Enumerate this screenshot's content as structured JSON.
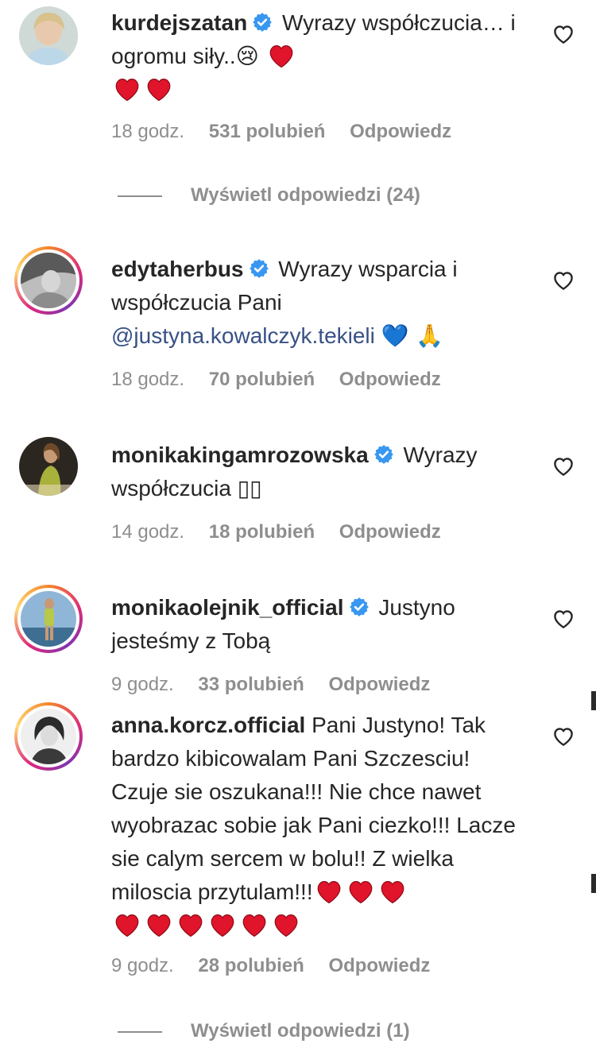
{
  "comments": [
    {
      "username": "kurdejszatan",
      "text_before_emoji": "Wyrazy współczucia… i ogromu siły..",
      "emojis_trailing": "😢",
      "time": "18 godz.",
      "likes": "531 polubień",
      "reply": "Odpowiedz",
      "view_replies": "Wyświetl odpowiedzi (24)"
    },
    {
      "username": "edytaherbus",
      "text": "Wyrazy wsparcia i współczucia Pani",
      "mention": "@justyna.kowalczyk.tekieli",
      "emojis": "💙 🙏",
      "time": "18 godz.",
      "likes": "70 polubień",
      "reply": "Odpowiedz"
    },
    {
      "username": "monikakingamrozowska",
      "text": "Wyrazy współczucia",
      "missing_glyphs": "▯▯",
      "time": "14 godz.",
      "likes": "18 polubień",
      "reply": "Odpowiedz"
    },
    {
      "username": "monikaolejnik_official",
      "text": "Justyno jesteśmy z Tobą",
      "time": "9 godz.",
      "likes": "33 polubień",
      "reply": "Odpowiedz"
    },
    {
      "username": "anna.korcz.official",
      "text": "Pani Justyno! Tak bardzo kibicowalam Pani Szczesciu! Czuje sie oszukana!!! Nie chce nawet wyobrazac sobie jak Pani ciezko!!! Lacze sie calym sercem w bolu!! Z wielka miloscia przytulam!!!",
      "time": "9 godz.",
      "likes": "28 polubień",
      "reply": "Odpowiedz",
      "view_replies": "Wyświetl odpowiedzi (1)"
    }
  ],
  "icons": {
    "verified": "verified-badge-icon",
    "like": "heart-outline-icon",
    "emoji_heart": "red-heart-emoji"
  },
  "colors": {
    "verified": "#3897f0",
    "mention": "#385185",
    "meta": "#8e8e8e",
    "heart": "#e0142a"
  }
}
